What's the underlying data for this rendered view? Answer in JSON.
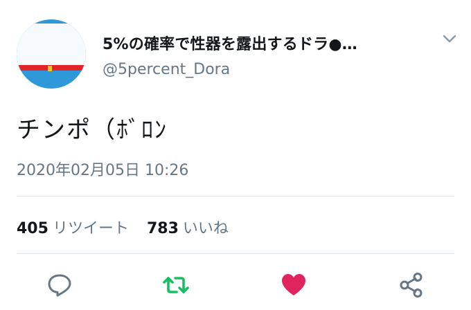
{
  "profile": {
    "display_name": "5%の確率で性器を露出するドラ●…",
    "handle": "@5percent_Dora"
  },
  "tweet": {
    "text": "チンポ（ﾎﾞﾛﾝ",
    "timestamp": "2020年02月05日 10:26"
  },
  "stats": {
    "retweets_count": "405",
    "retweets_label": "リツイート",
    "likes_count": "783",
    "likes_label": "いいね"
  },
  "actions": {
    "reply_icon": "reply-icon",
    "retweet_icon": "retweet-icon",
    "like_icon": "heart-icon",
    "share_icon": "share-icon"
  },
  "colors": {
    "text": "#14171a",
    "secondary": "#657786",
    "retweet_green": "#17bf63",
    "like_red": "#e0245e",
    "divider": "#e1e8ed",
    "avatar_blue": "#2f98d8",
    "avatar_collar": "#e0242a"
  }
}
